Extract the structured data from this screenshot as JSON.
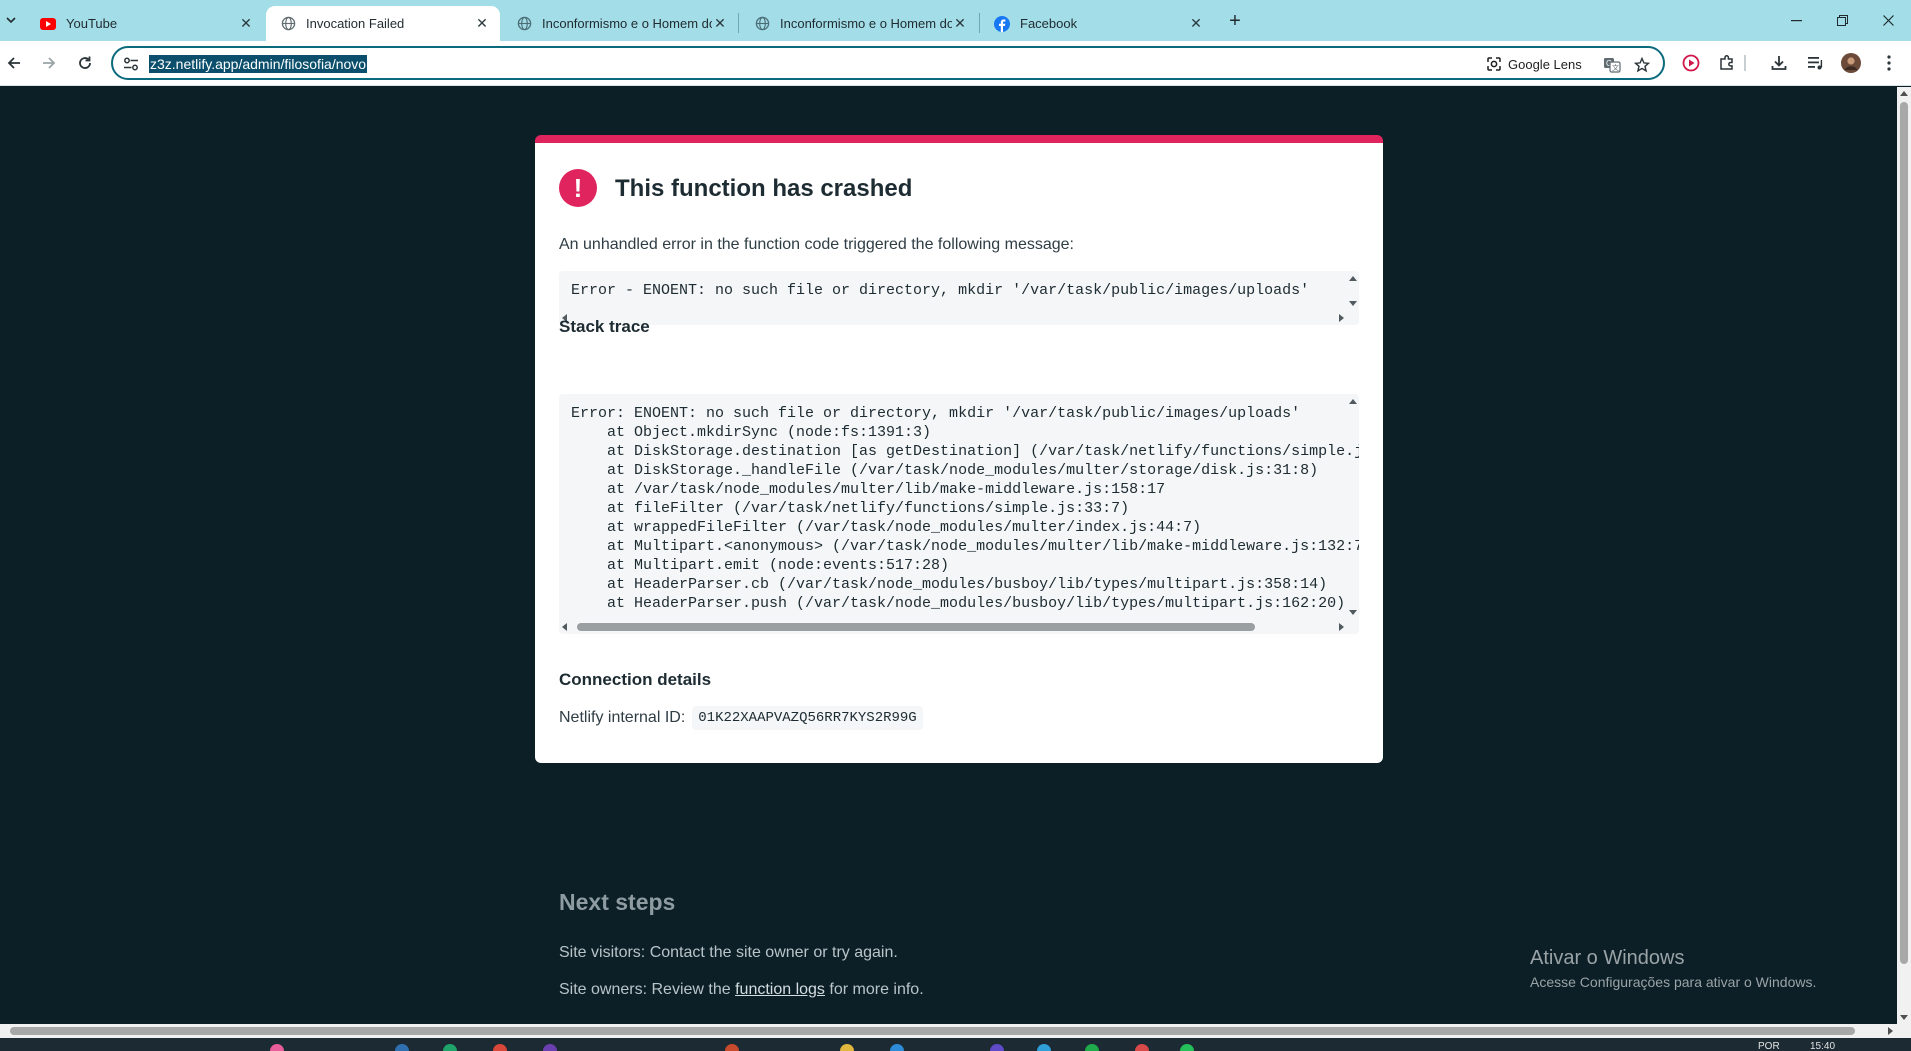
{
  "browser": {
    "tabs": [
      {
        "title": "YouTube",
        "favicon": "youtube-icon",
        "active": false
      },
      {
        "title": "Invocation Failed",
        "favicon": "globe-icon",
        "active": true
      },
      {
        "title": "Inconformismo e o Homem do",
        "favicon": "globe-icon",
        "active": false
      },
      {
        "title": "Inconformismo e o Homem do",
        "favicon": "globe-icon",
        "active": false
      },
      {
        "title": "Facebook",
        "favicon": "facebook-icon",
        "active": false
      }
    ],
    "url": "z3z.netlify.app/admin/filosofia/novo",
    "lens_label": "Google Lens"
  },
  "error_card": {
    "accent_color": "#e0245e",
    "title": "This function has crashed",
    "intro": "An unhandled error in the function code triggered the following message:",
    "error_message": "Error - ENOENT: no such file or directory, mkdir '/var/task/public/images/uploads'",
    "stack_trace_heading": "Stack trace",
    "stack_trace": "Error: ENOENT: no such file or directory, mkdir '/var/task/public/images/uploads'\n    at Object.mkdirSync (node:fs:1391:3)\n    at DiskStorage.destination [as getDestination] (/var/task/netlify/functions/simple.j\n    at DiskStorage._handleFile (/var/task/node_modules/multer/storage/disk.js:31:8)\n    at /var/task/node_modules/multer/lib/make-middleware.js:158:17\n    at fileFilter (/var/task/netlify/functions/simple.js:33:7)\n    at wrappedFileFilter (/var/task/node_modules/multer/index.js:44:7)\n    at Multipart.<anonymous> (/var/task/node_modules/multer/lib/make-middleware.js:132:7\n    at Multipart.emit (node:events:517:28)\n    at HeaderParser.cb (/var/task/node_modules/busboy/lib/types/multipart.js:358:14)\n    at HeaderParser.push (/var/task/node_modules/busboy/lib/types/multipart.js:162:20)",
    "connection_heading": "Connection details",
    "internal_id_label": "Netlify internal ID:",
    "internal_id": "01K22XAAPVAZQ56RR7KYS2R99G"
  },
  "next_steps": {
    "title": "Next steps",
    "visitors": "Site visitors: Contact the site owner or try again.",
    "owners_prefix": "Site owners: Review the",
    "owners_link": "function logs",
    "owners_suffix": "for more info."
  },
  "windows_watermark": {
    "line1": "Ativar o Windows",
    "line2": "Acesse Configurações para ativar o Windows."
  },
  "taskbar": {
    "lang": "POR",
    "time": "15:40"
  }
}
